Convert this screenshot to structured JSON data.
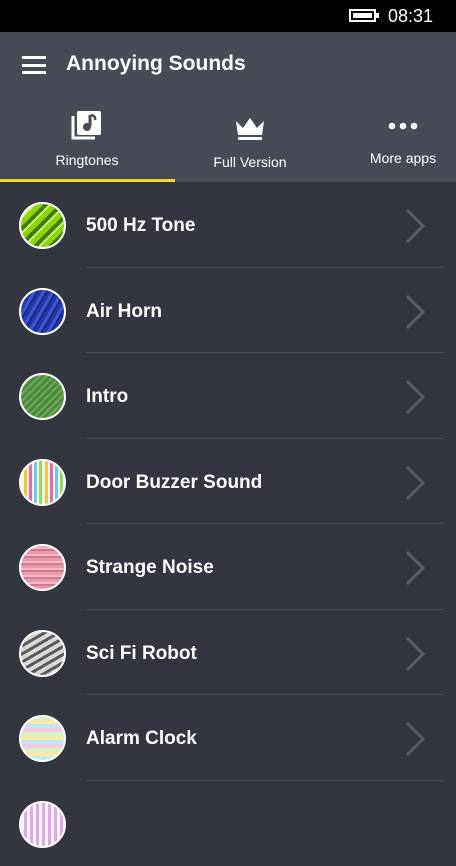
{
  "status": {
    "time": "08:31"
  },
  "header": {
    "title": "Annoying Sounds",
    "menu_icon": "hamburger-icon"
  },
  "tabs": [
    {
      "label": "Ringtones",
      "icon": "music-library-icon",
      "selected": true
    },
    {
      "label": "Full Version",
      "icon": "crown-icon",
      "selected": false
    },
    {
      "label": "More apps",
      "icon": "more-dots-icon",
      "selected": false
    }
  ],
  "colors": {
    "accent": "#f2d72e",
    "header_bg": "#474b56",
    "list_bg": "#33363f"
  },
  "sounds": [
    {
      "title": "500 Hz Tone"
    },
    {
      "title": "Air Horn"
    },
    {
      "title": "Intro"
    },
    {
      "title": "Door Buzzer Sound"
    },
    {
      "title": "Strange Noise"
    },
    {
      "title": "Sci Fi Robot"
    },
    {
      "title": "Alarm Clock"
    }
  ]
}
